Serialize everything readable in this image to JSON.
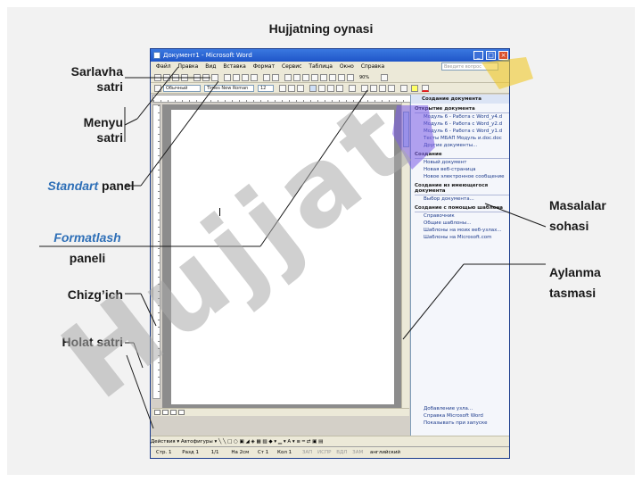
{
  "title": "Hujjatning oynasi",
  "labels": {
    "title_bar": [
      "Sarlavha",
      "satri"
    ],
    "menu_bar": [
      "Menyu",
      "satri"
    ],
    "standard_panel": {
      "italic": "Standart",
      "rest": " panel"
    },
    "formatting_panel": {
      "italic": "Formatlash",
      "rest": "paneli"
    },
    "ruler": "Chizg’ich",
    "status_bar": "Holat satri",
    "task_pane": [
      "Masalalar",
      "sohasi"
    ],
    "scrollbar": [
      "Aylanma",
      "tasmasi"
    ]
  },
  "word": {
    "window_title": "Документ1 - Microsoft Word",
    "menu": [
      "Файл",
      "Правка",
      "Вид",
      "Вставка",
      "Формат",
      "Сервис",
      "Таблица",
      "Окно",
      "Справка"
    ],
    "ask_placeholder": "Введите вопрос",
    "style": "Обычный",
    "font": "Times New Roman",
    "font_size": "12",
    "zoom": "90%",
    "task_pane": {
      "header": "Создание документа",
      "open_heading": "Открытие документа",
      "open_items": [
        "Модуль 6 - Работа с Word_у4.d",
        "Модуль 6 - Работа с Word_у2.d",
        "Модуль 6 - Работа с Word_у1.d",
        "Тесты МБАП Модуль и.doc.doc"
      ],
      "more_docs": "Другие документы...",
      "create_heading": "Создание",
      "create_items": [
        "Новый документ",
        "Новая веб-страница",
        "Новое электронное сообщение"
      ],
      "existing_heading": "Создание из имеющегося документа",
      "existing_item": "Выбор документа...",
      "template_heading": "Создание с помощью шаблона",
      "template_items": [
        "Справочник",
        "Общие шаблоны...",
        "Шаблоны на моих веб-узлах...",
        "Шаблоны на Microsoft.com"
      ],
      "bottom_items": [
        "Добавление узла...",
        "Справка Microsoft Word",
        "Показывать при запуске"
      ]
    },
    "draw_bar": "Действия ▾    Автофигуры ▾   ╲  ╲  □  ○  ▣  ◢  ◈  ▦  ▨   ◆ ▾  ▁ ▾  A ▾  ≡  ═  ⇄  ▣  ▤",
    "status": [
      "Стр. 1",
      "Разд 1",
      "1/1",
      "На 2см",
      "Ст 1",
      "Кол 1",
      "ЗАП",
      "ИСПР",
      "ВДЛ",
      "ЗАМ",
      "английский"
    ]
  },
  "watermark": "Hujjat"
}
